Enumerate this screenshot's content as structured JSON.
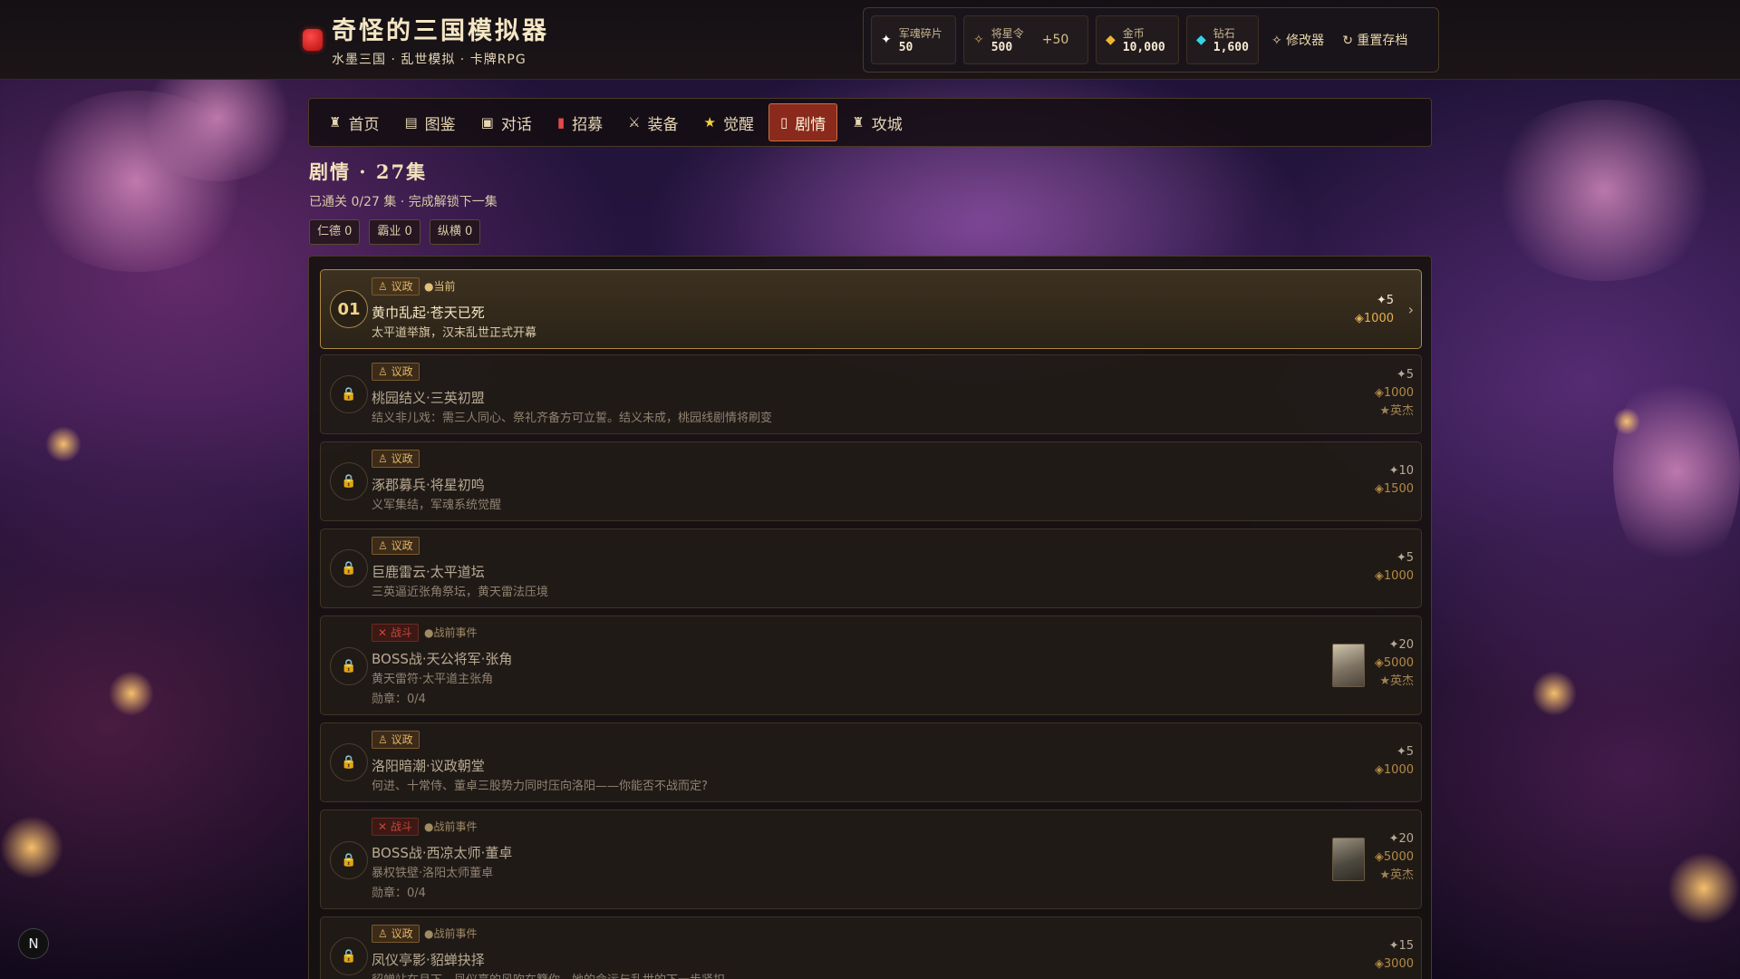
{
  "brand": {
    "title": "奇怪的三国模拟器",
    "subtitle": "水墨三国 · 乱世模拟 · 卡牌RPG"
  },
  "resources": [
    {
      "icon": "✦",
      "label": "军魂碎片",
      "value": "50",
      "plus": ""
    },
    {
      "icon": "✧",
      "label": "将星令",
      "value": "500",
      "plus": "+50"
    },
    {
      "icon": "◆",
      "label": "金币",
      "value": "10,000",
      "plus": ""
    },
    {
      "icon": "◆",
      "label": "钻石",
      "value": "1,600",
      "plus": ""
    }
  ],
  "tools": {
    "modifier": "✧ 修改器",
    "reset": "↻ 重置存档"
  },
  "nav": [
    {
      "icon": "♜",
      "label": "首页"
    },
    {
      "icon": "▤",
      "label": "图鉴"
    },
    {
      "icon": "▣",
      "label": "对话"
    },
    {
      "icon": "▮",
      "label": "招募"
    },
    {
      "icon": "⚔",
      "label": "装备"
    },
    {
      "icon": "★",
      "label": "觉醒"
    },
    {
      "icon": "▯",
      "label": "剧情"
    },
    {
      "icon": "♜",
      "label": "攻城"
    }
  ],
  "header": {
    "title": "剧情 · 27集",
    "subtitle": "已通关 0/27 集 · 完成解锁下一集",
    "tags": [
      "仁德 0",
      "霸业 0",
      "纵横 0"
    ]
  },
  "episodes": [
    {
      "num": "01",
      "badge": "♙ 议政",
      "status": "●当前",
      "title": "黄巾乱起·苍天已死",
      "desc": "太平道举旗，汉末乱世正式开幕",
      "medal": "",
      "r1": "✦5",
      "r2": "◈1000",
      "r3": ""
    },
    {
      "num": "🔒",
      "badge": "♙ 议政",
      "status": "",
      "title": "桃园结义·三英初盟",
      "desc": "结义非儿戏：需三人同心、祭礼齐备方可立誓。结义未成，桃园线剧情将刷变",
      "medal": "",
      "r1": "✦5",
      "r2": "◈1000",
      "r3": "★英杰"
    },
    {
      "num": "🔒",
      "badge": "♙ 议政",
      "status": "",
      "title": "涿郡募兵·将星初鸣",
      "desc": "义军集结，军魂系统觉醒",
      "medal": "",
      "r1": "✦10",
      "r2": "◈1500",
      "r3": ""
    },
    {
      "num": "🔒",
      "badge": "♙ 议政",
      "status": "",
      "title": "巨鹿雷云·太平道坛",
      "desc": "三英逼近张角祭坛，黄天雷法压境",
      "medal": "",
      "r1": "✦5",
      "r2": "◈1000",
      "r3": ""
    },
    {
      "num": "🔒",
      "badge": "✕ 战斗",
      "status": "●战前事件",
      "title": "BOSS战·天公将军·张角",
      "desc": "黄天雷符·太平道主张角",
      "medal": "勋章：0/4",
      "r1": "✦20",
      "r2": "◈5000",
      "r3": "★英杰"
    },
    {
      "num": "🔒",
      "badge": "♙ 议政",
      "status": "",
      "title": "洛阳暗潮·议政朝堂",
      "desc": "何进、十常侍、董卓三股势力同时压向洛阳——你能否不战而定?",
      "medal": "",
      "r1": "✦5",
      "r2": "◈1000",
      "r3": ""
    },
    {
      "num": "🔒",
      "badge": "✕ 战斗",
      "status": "●战前事件",
      "title": "BOSS战·西凉太师·董卓",
      "desc": "暴权铁壁·洛阳太师董卓",
      "medal": "勋章：0/4",
      "r1": "✦20",
      "r2": "◈5000",
      "r3": "★英杰"
    },
    {
      "num": "🔒",
      "badge": "♙ 议政",
      "status": "●战前事件",
      "title": "凤仪亭影·貂蝉抉择",
      "desc": "貂蝉站在月下，凤仪亭的风吹在簪你，她的命运与乱世的下一步紧扣",
      "medal": "",
      "r1": "✦15",
      "r2": "◈3000",
      "r3": ""
    }
  ],
  "corner_badge": "N",
  "colors": {
    "accent": "#8a2a1c",
    "gold": "#e6b04e",
    "panel": "#16120f"
  }
}
